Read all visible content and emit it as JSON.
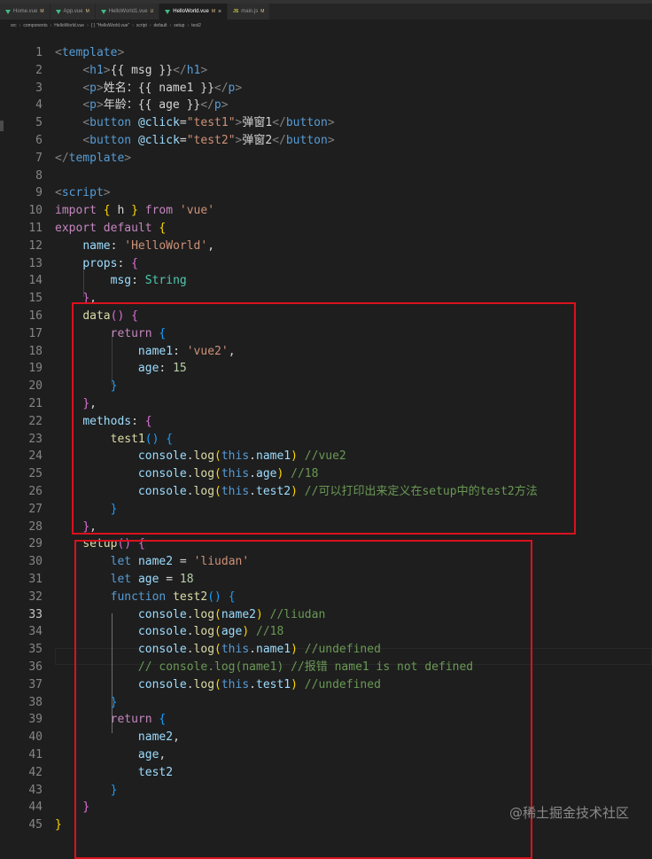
{
  "tabs": [
    {
      "label": "Home.vue",
      "icon": "vue-icon",
      "marker": "M",
      "active": false
    },
    {
      "label": "App.vue",
      "icon": "vue-icon",
      "marker": "M",
      "active": false
    },
    {
      "label": "HelloWorld1.vue",
      "icon": "vue-icon",
      "marker": "U",
      "active": false
    },
    {
      "label": "HelloWorld.vue",
      "icon": "vue-icon",
      "marker": "M",
      "active": true
    },
    {
      "label": "main.js",
      "icon": "js-icon",
      "marker": "M",
      "active": false
    }
  ],
  "breadcrumb": [
    "src",
    "components",
    "HelloWorld.vue",
    "{ } \"HelloWorld.vue\"",
    "script",
    "default",
    "setup",
    "test2"
  ],
  "current_line": 33,
  "code_lines": [
    {
      "n": 1,
      "tokens": [
        [
          "tag",
          "<"
        ],
        [
          "tn",
          "template"
        ],
        [
          "tag",
          ">"
        ]
      ]
    },
    {
      "n": 2,
      "tokens": [
        [
          "txt",
          "    "
        ],
        [
          "tag",
          "<"
        ],
        [
          "tn",
          "h1"
        ],
        [
          "tag",
          ">"
        ],
        [
          "txt",
          "{{ msg }}"
        ],
        [
          "tag",
          "</"
        ],
        [
          "tn",
          "h1"
        ],
        [
          "tag",
          ">"
        ]
      ]
    },
    {
      "n": 3,
      "tokens": [
        [
          "txt",
          "    "
        ],
        [
          "tag",
          "<"
        ],
        [
          "tn",
          "p"
        ],
        [
          "tag",
          ">"
        ],
        [
          "txt",
          "姓名：{{ name1 }}"
        ],
        [
          "tag",
          "</"
        ],
        [
          "tn",
          "p"
        ],
        [
          "tag",
          ">"
        ]
      ]
    },
    {
      "n": 4,
      "tokens": [
        [
          "txt",
          "    "
        ],
        [
          "tag",
          "<"
        ],
        [
          "tn",
          "p"
        ],
        [
          "tag",
          ">"
        ],
        [
          "txt",
          "年龄：{{ age }}"
        ],
        [
          "tag",
          "</"
        ],
        [
          "tn",
          "p"
        ],
        [
          "tag",
          ">"
        ]
      ]
    },
    {
      "n": 5,
      "tokens": [
        [
          "txt",
          "    "
        ],
        [
          "tag",
          "<"
        ],
        [
          "tn",
          "button"
        ],
        [
          "txt",
          " "
        ],
        [
          "prop",
          "@click"
        ],
        [
          "txt",
          "="
        ],
        [
          "str",
          "\"test1\""
        ],
        [
          "tag",
          ">"
        ],
        [
          "txt",
          "弹窗1"
        ],
        [
          "tag",
          "</"
        ],
        [
          "tn",
          "button"
        ],
        [
          "tag",
          ">"
        ]
      ]
    },
    {
      "n": 6,
      "tokens": [
        [
          "txt",
          "    "
        ],
        [
          "tag",
          "<"
        ],
        [
          "tn",
          "button"
        ],
        [
          "txt",
          " "
        ],
        [
          "prop",
          "@click"
        ],
        [
          "txt",
          "="
        ],
        [
          "str",
          "\"test2\""
        ],
        [
          "tag",
          ">"
        ],
        [
          "txt",
          "弹窗2"
        ],
        [
          "tag",
          "</"
        ],
        [
          "tn",
          "button"
        ],
        [
          "tag",
          ">"
        ]
      ]
    },
    {
      "n": 7,
      "tokens": [
        [
          "tag",
          "</"
        ],
        [
          "tn",
          "template"
        ],
        [
          "tag",
          ">"
        ]
      ]
    },
    {
      "n": 8,
      "tokens": []
    },
    {
      "n": 9,
      "tokens": [
        [
          "tag",
          "<"
        ],
        [
          "tn",
          "script"
        ],
        [
          "tag",
          ">"
        ]
      ]
    },
    {
      "n": 10,
      "tokens": [
        [
          "kw",
          "import"
        ],
        [
          "txt",
          " "
        ],
        [
          "br1",
          "{"
        ],
        [
          "txt",
          " h "
        ],
        [
          "br1",
          "}"
        ],
        [
          "txt",
          " "
        ],
        [
          "kw",
          "from"
        ],
        [
          "txt",
          " "
        ],
        [
          "str",
          "'vue'"
        ]
      ]
    },
    {
      "n": 11,
      "tokens": [
        [
          "kw",
          "export"
        ],
        [
          "txt",
          " "
        ],
        [
          "kw",
          "default"
        ],
        [
          "txt",
          " "
        ],
        [
          "br1",
          "{"
        ]
      ]
    },
    {
      "n": 12,
      "tokens": [
        [
          "txt",
          "    "
        ],
        [
          "prop",
          "name"
        ],
        [
          "txt",
          ": "
        ],
        [
          "str",
          "'HelloWorld'"
        ],
        [
          "txt",
          ","
        ]
      ]
    },
    {
      "n": 13,
      "tokens": [
        [
          "txt",
          "    "
        ],
        [
          "prop",
          "props"
        ],
        [
          "txt",
          ": "
        ],
        [
          "br2",
          "{"
        ]
      ]
    },
    {
      "n": 14,
      "tokens": [
        [
          "txt",
          "        "
        ],
        [
          "prop",
          "msg"
        ],
        [
          "txt",
          ": "
        ],
        [
          "cls",
          "String"
        ]
      ]
    },
    {
      "n": 15,
      "tokens": [
        [
          "txt",
          "    "
        ],
        [
          "br2",
          "}"
        ],
        [
          "txt",
          ","
        ]
      ]
    },
    {
      "n": 16,
      "tokens": [
        [
          "txt",
          "    "
        ],
        [
          "fn",
          "data"
        ],
        [
          "br2",
          "()"
        ],
        [
          "txt",
          " "
        ],
        [
          "br2",
          "{"
        ]
      ]
    },
    {
      "n": 17,
      "tokens": [
        [
          "txt",
          "        "
        ],
        [
          "kw",
          "return"
        ],
        [
          "txt",
          " "
        ],
        [
          "br3",
          "{"
        ]
      ]
    },
    {
      "n": 18,
      "tokens": [
        [
          "txt",
          "            "
        ],
        [
          "prop",
          "name1"
        ],
        [
          "txt",
          ": "
        ],
        [
          "str",
          "'vue2'"
        ],
        [
          "txt",
          ","
        ]
      ]
    },
    {
      "n": 19,
      "tokens": [
        [
          "txt",
          "            "
        ],
        [
          "prop",
          "age"
        ],
        [
          "txt",
          ": "
        ],
        [
          "num",
          "15"
        ]
      ]
    },
    {
      "n": 20,
      "tokens": [
        [
          "txt",
          "        "
        ],
        [
          "br3",
          "}"
        ]
      ]
    },
    {
      "n": 21,
      "tokens": [
        [
          "txt",
          "    "
        ],
        [
          "br2",
          "}"
        ],
        [
          "txt",
          ","
        ]
      ]
    },
    {
      "n": 22,
      "tokens": [
        [
          "txt",
          "    "
        ],
        [
          "prop",
          "methods"
        ],
        [
          "txt",
          ": "
        ],
        [
          "br2",
          "{"
        ]
      ]
    },
    {
      "n": 23,
      "tokens": [
        [
          "txt",
          "        "
        ],
        [
          "fn",
          "test1"
        ],
        [
          "br3",
          "()"
        ],
        [
          "txt",
          " "
        ],
        [
          "br3",
          "{"
        ]
      ]
    },
    {
      "n": 24,
      "tokens": [
        [
          "txt",
          "            "
        ],
        [
          "prop",
          "console"
        ],
        [
          "txt",
          "."
        ],
        [
          "fn",
          "log"
        ],
        [
          "br1",
          "("
        ],
        [
          "kb",
          "this"
        ],
        [
          "txt",
          "."
        ],
        [
          "prop",
          "name1"
        ],
        [
          "br1",
          ")"
        ],
        [
          "txt",
          " "
        ],
        [
          "cm",
          "//vue2"
        ]
      ]
    },
    {
      "n": 25,
      "tokens": [
        [
          "txt",
          "            "
        ],
        [
          "prop",
          "console"
        ],
        [
          "txt",
          "."
        ],
        [
          "fn",
          "log"
        ],
        [
          "br1",
          "("
        ],
        [
          "kb",
          "this"
        ],
        [
          "txt",
          "."
        ],
        [
          "prop",
          "age"
        ],
        [
          "br1",
          ")"
        ],
        [
          "txt",
          " "
        ],
        [
          "cm",
          "//18"
        ]
      ]
    },
    {
      "n": 26,
      "tokens": [
        [
          "txt",
          "            "
        ],
        [
          "prop",
          "console"
        ],
        [
          "txt",
          "."
        ],
        [
          "fn",
          "log"
        ],
        [
          "br1",
          "("
        ],
        [
          "kb",
          "this"
        ],
        [
          "txt",
          "."
        ],
        [
          "prop",
          "test2"
        ],
        [
          "br1",
          ")"
        ],
        [
          "txt",
          " "
        ],
        [
          "cm",
          "//可以打印出来定义在setup中的test2方法"
        ]
      ]
    },
    {
      "n": 27,
      "tokens": [
        [
          "txt",
          "        "
        ],
        [
          "br3",
          "}"
        ]
      ]
    },
    {
      "n": 28,
      "tokens": [
        [
          "txt",
          "    "
        ],
        [
          "br2",
          "}"
        ],
        [
          "txt",
          ","
        ]
      ]
    },
    {
      "n": 29,
      "tokens": [
        [
          "txt",
          "    "
        ],
        [
          "fn",
          "setup"
        ],
        [
          "br2",
          "()"
        ],
        [
          "txt",
          " "
        ],
        [
          "br2",
          "{"
        ]
      ]
    },
    {
      "n": 30,
      "tokens": [
        [
          "txt",
          "        "
        ],
        [
          "kb",
          "let"
        ],
        [
          "txt",
          " "
        ],
        [
          "prop",
          "name2"
        ],
        [
          "txt",
          " = "
        ],
        [
          "str",
          "'liudan'"
        ]
      ]
    },
    {
      "n": 31,
      "tokens": [
        [
          "txt",
          "        "
        ],
        [
          "kb",
          "let"
        ],
        [
          "txt",
          " "
        ],
        [
          "prop",
          "age"
        ],
        [
          "txt",
          " = "
        ],
        [
          "num",
          "18"
        ]
      ]
    },
    {
      "n": 32,
      "tokens": [
        [
          "txt",
          "        "
        ],
        [
          "kb",
          "function"
        ],
        [
          "txt",
          " "
        ],
        [
          "fn",
          "test2"
        ],
        [
          "br3",
          "()"
        ],
        [
          "txt",
          " "
        ],
        [
          "br3",
          "{"
        ]
      ]
    },
    {
      "n": 33,
      "tokens": [
        [
          "txt",
          "            "
        ],
        [
          "prop",
          "console"
        ],
        [
          "txt",
          "."
        ],
        [
          "fn",
          "log"
        ],
        [
          "br1",
          "("
        ],
        [
          "prop",
          "name2"
        ],
        [
          "br1",
          ")"
        ],
        [
          "txt",
          " "
        ],
        [
          "cm",
          "//liudan"
        ]
      ]
    },
    {
      "n": 34,
      "tokens": [
        [
          "txt",
          "            "
        ],
        [
          "prop",
          "console"
        ],
        [
          "txt",
          "."
        ],
        [
          "fn",
          "log"
        ],
        [
          "br1",
          "("
        ],
        [
          "prop",
          "age"
        ],
        [
          "br1",
          ")"
        ],
        [
          "txt",
          " "
        ],
        [
          "cm",
          "//18"
        ]
      ]
    },
    {
      "n": 35,
      "tokens": [
        [
          "txt",
          "            "
        ],
        [
          "prop",
          "console"
        ],
        [
          "txt",
          "."
        ],
        [
          "fn",
          "log"
        ],
        [
          "br1",
          "("
        ],
        [
          "kb",
          "this"
        ],
        [
          "txt",
          "."
        ],
        [
          "prop",
          "name1"
        ],
        [
          "br1",
          ")"
        ],
        [
          "txt",
          " "
        ],
        [
          "cm",
          "//undefined"
        ]
      ]
    },
    {
      "n": 36,
      "tokens": [
        [
          "txt",
          "            "
        ],
        [
          "cm",
          "// console.log(name1) //报错 name1 is not defined"
        ]
      ]
    },
    {
      "n": 37,
      "tokens": [
        [
          "txt",
          "            "
        ],
        [
          "prop",
          "console"
        ],
        [
          "txt",
          "."
        ],
        [
          "fn",
          "log"
        ],
        [
          "br1",
          "("
        ],
        [
          "kb",
          "this"
        ],
        [
          "txt",
          "."
        ],
        [
          "prop",
          "test1"
        ],
        [
          "br1",
          ")"
        ],
        [
          "txt",
          " "
        ],
        [
          "cm",
          "//undefined"
        ]
      ]
    },
    {
      "n": 38,
      "tokens": [
        [
          "txt",
          "        "
        ],
        [
          "br3",
          "}"
        ]
      ]
    },
    {
      "n": 39,
      "tokens": [
        [
          "txt",
          "        "
        ],
        [
          "kw",
          "return"
        ],
        [
          "txt",
          " "
        ],
        [
          "br3",
          "{"
        ]
      ]
    },
    {
      "n": 40,
      "tokens": [
        [
          "txt",
          "            "
        ],
        [
          "prop",
          "name2"
        ],
        [
          "txt",
          ","
        ]
      ]
    },
    {
      "n": 41,
      "tokens": [
        [
          "txt",
          "            "
        ],
        [
          "prop",
          "age"
        ],
        [
          "txt",
          ","
        ]
      ]
    },
    {
      "n": 42,
      "tokens": [
        [
          "txt",
          "            "
        ],
        [
          "prop",
          "test2"
        ]
      ]
    },
    {
      "n": 43,
      "tokens": [
        [
          "txt",
          "        "
        ],
        [
          "br3",
          "}"
        ]
      ]
    },
    {
      "n": 44,
      "tokens": [
        [
          "txt",
          "    "
        ],
        [
          "br2",
          "}"
        ]
      ]
    },
    {
      "n": 45,
      "tokens": [
        [
          "br1",
          "}"
        ]
      ]
    }
  ],
  "watermark": "@稀土掘金技术社区",
  "colors": {
    "annotation_box": "#d9121d",
    "background": "#1e1e1e"
  }
}
